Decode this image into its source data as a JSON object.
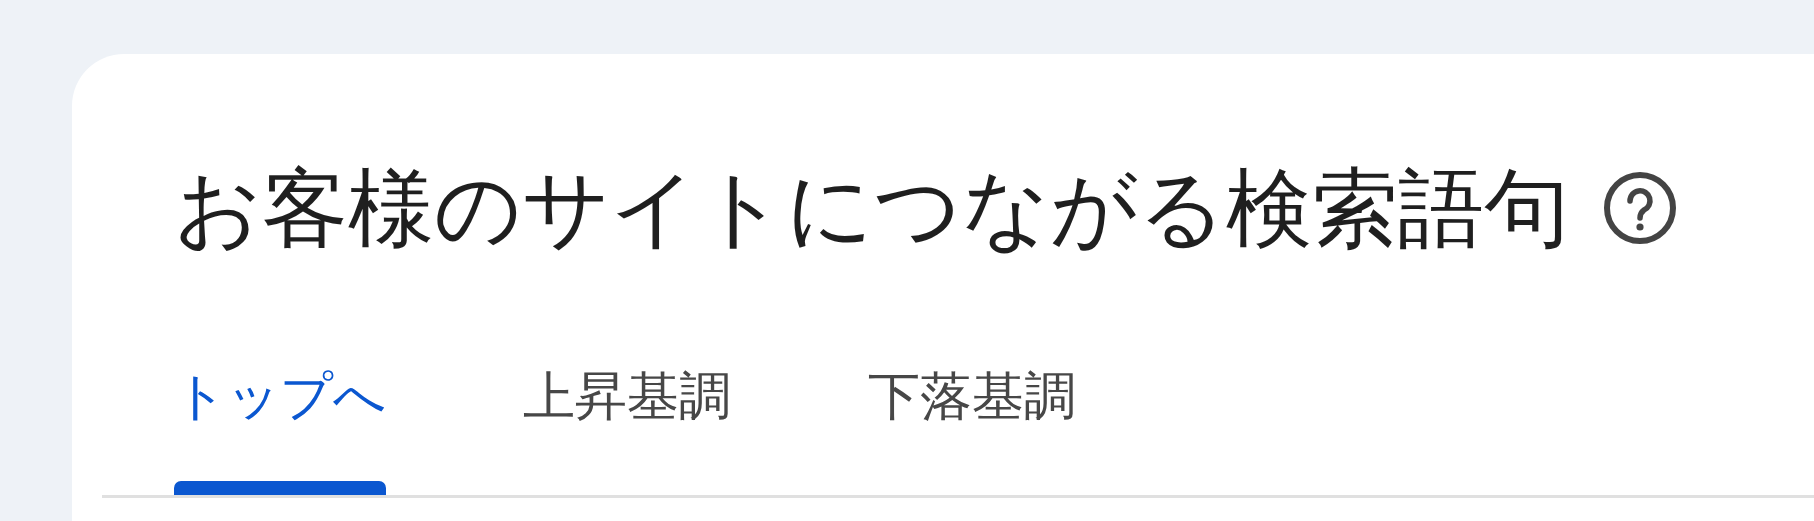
{
  "card": {
    "title": "お客様のサイトにつながる検索語句",
    "tabs": [
      {
        "label": "トップへ",
        "selected": true
      },
      {
        "label": "上昇基調",
        "selected": false
      },
      {
        "label": "下落基調",
        "selected": false
      }
    ]
  }
}
